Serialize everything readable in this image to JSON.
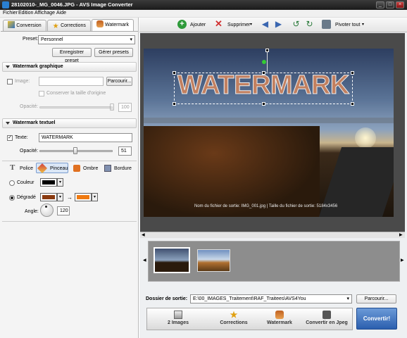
{
  "window": {
    "title": "28102010-_MG_0046.JPG - AVS Image Converter"
  },
  "menu": [
    "Fichier",
    "Edition",
    "Affichage",
    "Aide"
  ],
  "tabs": [
    {
      "label": "Conversion"
    },
    {
      "label": "Corrections"
    },
    {
      "label": "Watermark"
    }
  ],
  "preset": {
    "label": "Preset:",
    "value": "Personnel",
    "save": "Enregistrer preset",
    "manage": "Gérer presets"
  },
  "graphic": {
    "title": "Watermark graphique",
    "image_label": "Image:",
    "browse": "Parcourir...",
    "keep_size": "Conserver la taille d'origine",
    "opacity_label": "Opacité:",
    "opacity_value": "100"
  },
  "text_wm": {
    "title": "Watermark textuel",
    "text_label": "Texte:",
    "text_value": "WATERMARK",
    "opacity_label": "Opacité:",
    "opacity_value": "51",
    "opacity_level": 0.51
  },
  "style_tabs": [
    "Police",
    "Pinceau",
    "Ombre",
    "Bordure"
  ],
  "fill": {
    "color_label": "Couleur",
    "gradient_label": "Dégradé",
    "arrow": "→",
    "angle_label": "Angle:",
    "angle_value": "120",
    "colors": {
      "solid": "#000000",
      "grad_from": "#8a3a10",
      "grad_to": "#f07a10"
    }
  },
  "toolbar": {
    "add": "Ajouter",
    "delete": "Supprimer",
    "rotate_all": "Pivoter tout"
  },
  "preview": {
    "watermark": "WATERMARK",
    "caption": "Nom du fichier de sortie: IMG_001.jpg | Taille du fichier de sortie: 5184x3456"
  },
  "output": {
    "label": "Dossier de sortie:",
    "path": "E:\\00_IMAGES_Traitement\\RAF_Traitees\\AVS4You",
    "browse": "Parcourir..."
  },
  "workflow": [
    "2 Images",
    "Corrections",
    "Watermark",
    "Convertir en Jpeg"
  ],
  "convert": "Convertir!",
  "colors": {
    "accent": "#2b5fae",
    "add": "#2e9a3a",
    "delete": "#d03030"
  }
}
